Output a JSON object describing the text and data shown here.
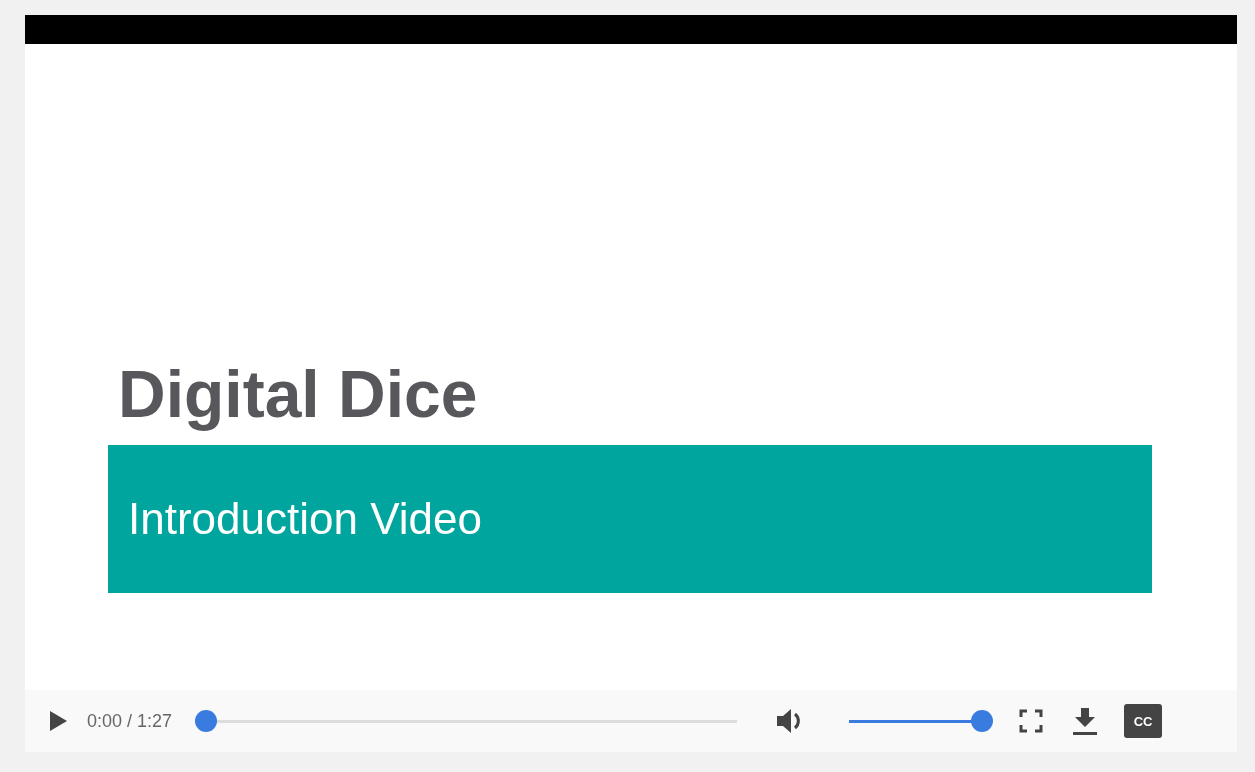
{
  "slide": {
    "title": "Digital Dice",
    "subtitle": "Introduction Video"
  },
  "controls": {
    "playing": false,
    "time": "0:00 / 1:27",
    "progress": {
      "level": 0
    },
    "muted": false,
    "volume": {
      "level": 1
    },
    "captions_label": "CC"
  }
}
